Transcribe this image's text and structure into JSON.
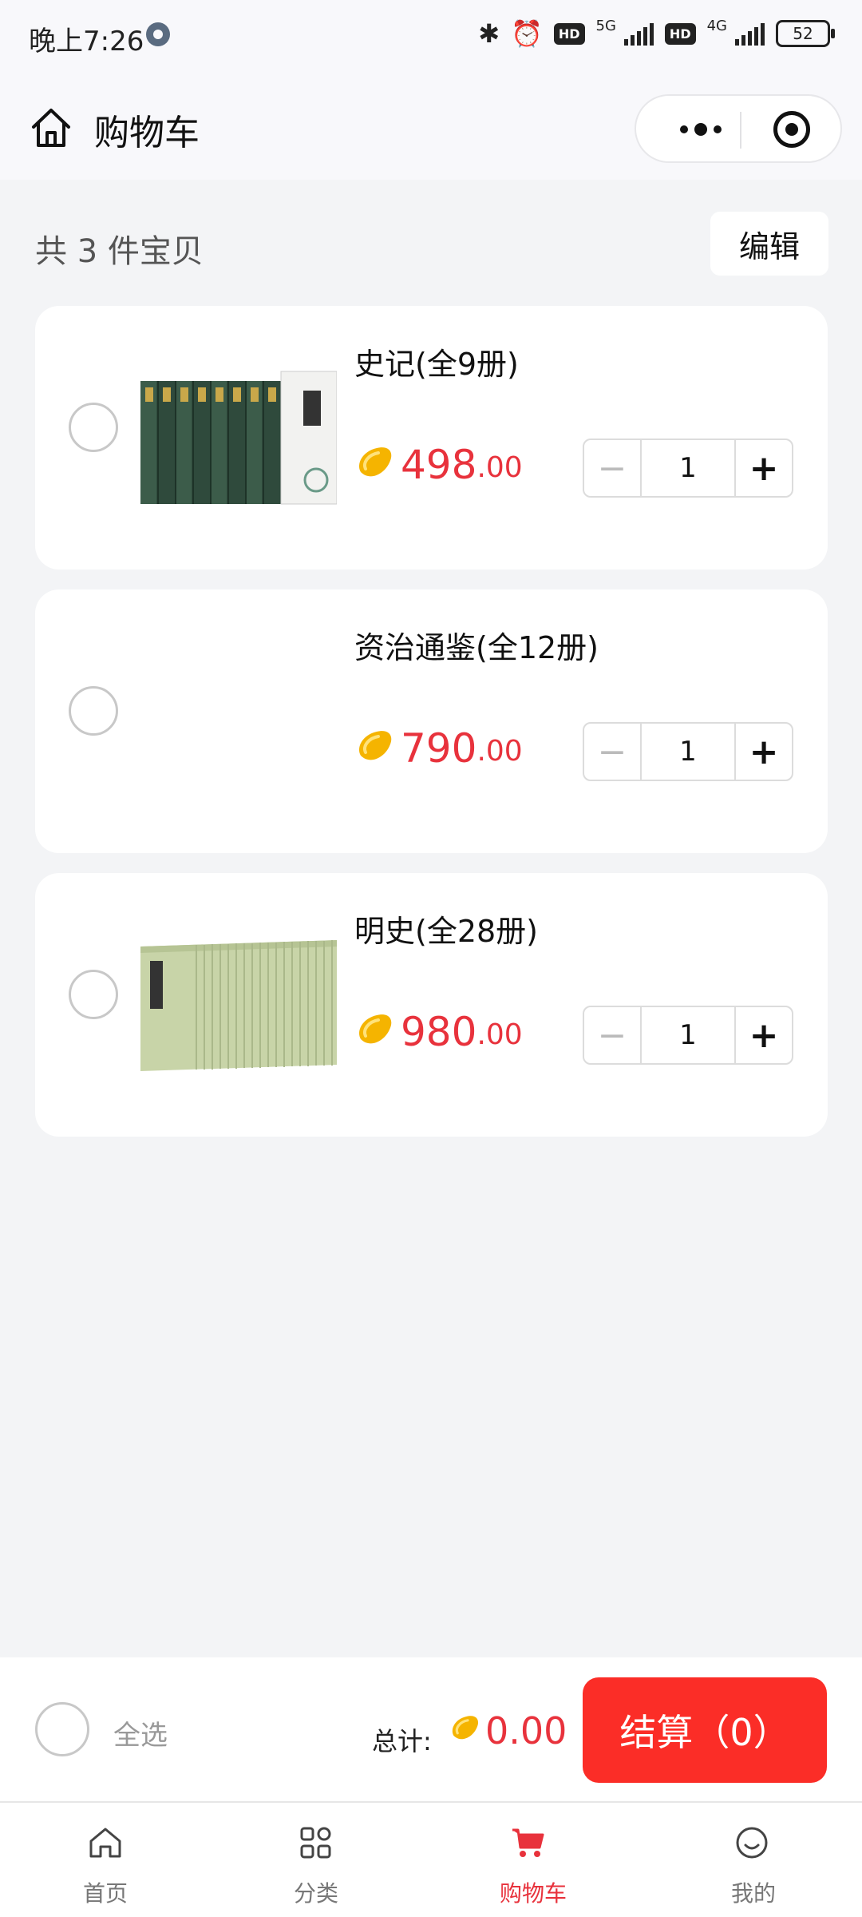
{
  "status_bar": {
    "time": "晚上7:26",
    "hd1": "HD",
    "net1": "5G",
    "hd2": "HD",
    "net2": "4G",
    "battery": "52"
  },
  "nav": {
    "title": "购物车"
  },
  "summary": {
    "count_text": "共 3 件宝贝",
    "edit_label": "编辑"
  },
  "items": [
    {
      "title": "史记(全9册)",
      "price_int": "498",
      "price_dec": ".00",
      "quantity": "1",
      "image": "book-set-green"
    },
    {
      "title": "资治通鉴(全12册)",
      "price_int": "790",
      "price_dec": ".00",
      "quantity": "1",
      "image": "none"
    },
    {
      "title": "明史(全28册)",
      "price_int": "980",
      "price_dec": ".00",
      "quantity": "1",
      "image": "book-set-light-green"
    }
  ],
  "stepper": {
    "minus": "−",
    "plus": "+"
  },
  "checkout": {
    "select_all_label": "全选",
    "total_label": "总计:",
    "total_value": "0.00",
    "checkout_label": "结算（0）"
  },
  "tabs": [
    {
      "label": "首页",
      "icon": "home-icon",
      "active": false
    },
    {
      "label": "分类",
      "icon": "category-grid-icon",
      "active": false
    },
    {
      "label": "购物车",
      "icon": "cart-icon",
      "active": true
    },
    {
      "label": "我的",
      "icon": "smiley-icon",
      "active": false
    }
  ],
  "colors": {
    "accent": "#e8323c",
    "checkout_button": "#fb2d27",
    "background": "#f3f4f6",
    "bean": "#f5b400"
  }
}
